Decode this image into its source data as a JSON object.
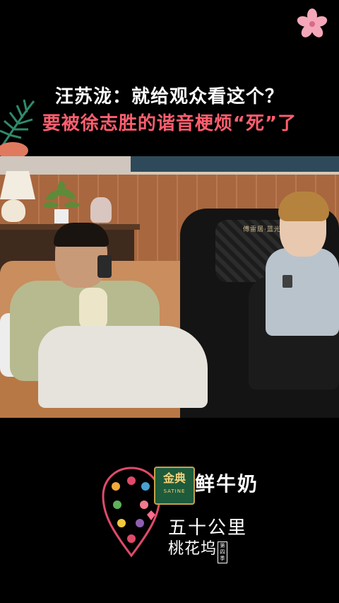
{
  "colors": {
    "background": "#000000",
    "headline_primary": "#ffffff",
    "headline_accent": "#ff5e6e",
    "flower": "#f4a7b9"
  },
  "headline": {
    "line1": "汪苏泷：就给观众看这个？",
    "line2": "要被徐志胜的谐音梗烦“死”了"
  },
  "scene": {
    "chair_label": "傅雷居·蓝光芝"
  },
  "sponsor": {
    "badge_main": "金典",
    "badge_sub": "SATINE",
    "product": "鲜牛奶",
    "show_line1": "五十公里",
    "show_line2": "桃花坞",
    "season": "第四季"
  },
  "icons": [
    "flower-icon",
    "leaf-icon",
    "heart-pin-icon"
  ]
}
